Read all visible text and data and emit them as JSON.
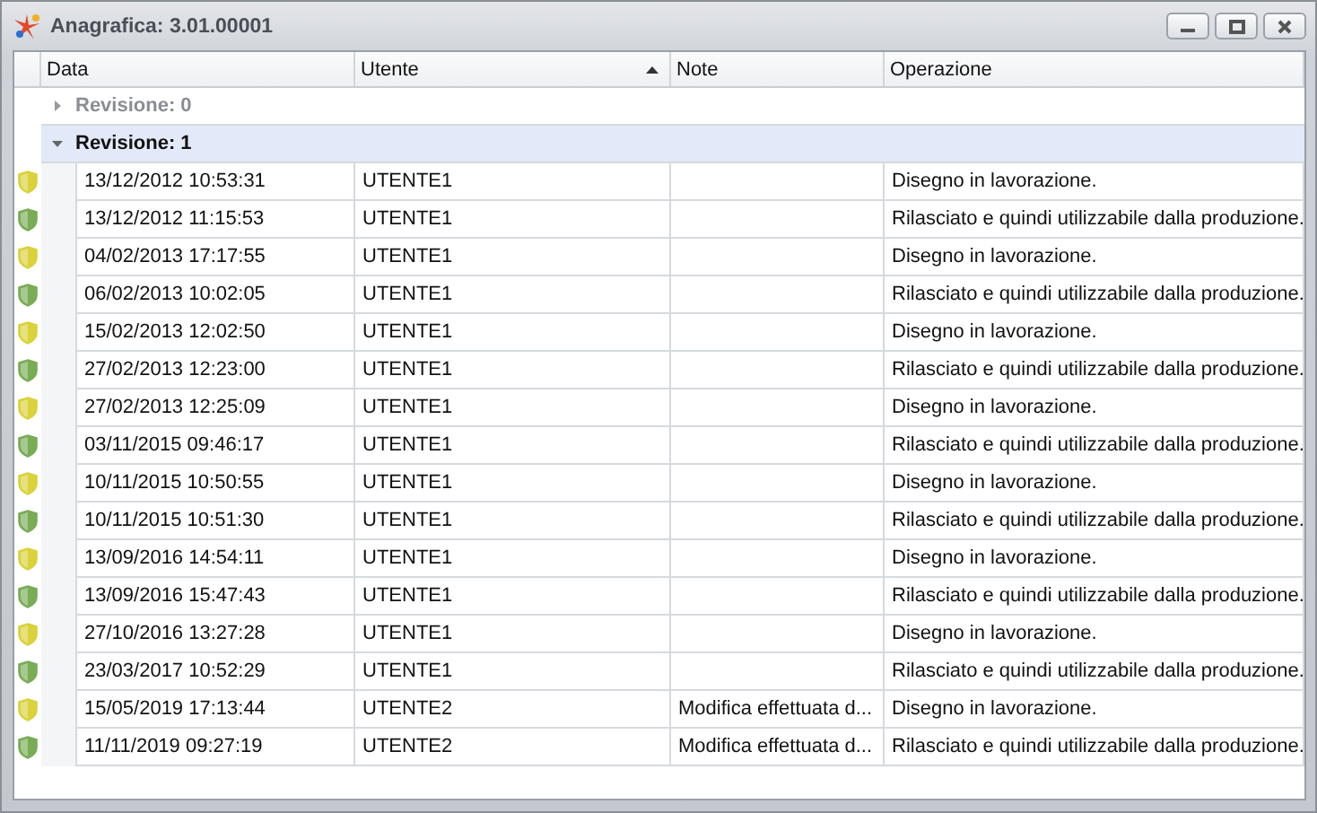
{
  "window": {
    "title": "Anagrafica: 3.01.00001"
  },
  "table": {
    "columns": [
      {
        "label": "Data",
        "sorted": false
      },
      {
        "label": "Utente",
        "sorted": true
      },
      {
        "label": "Note",
        "sorted": false
      },
      {
        "label": "Operazione",
        "sorted": false
      }
    ],
    "groups": [
      {
        "label": "Revisione: 0",
        "expanded": false,
        "selected": false
      },
      {
        "label": "Revisione: 1",
        "expanded": true,
        "selected": true,
        "rows": [
          {
            "color": "#d9d23a",
            "data": "13/12/2012 10:53:31",
            "utente": "UTENTE1",
            "note": "",
            "operazione": "Disegno in lavorazione."
          },
          {
            "color": "#78ac55",
            "data": "13/12/2012 11:15:53",
            "utente": "UTENTE1",
            "note": "",
            "operazione": "Rilasciato e quindi utilizzabile dalla produzione."
          },
          {
            "color": "#d9d23a",
            "data": "04/02/2013 17:17:55",
            "utente": "UTENTE1",
            "note": "",
            "operazione": "Disegno in lavorazione."
          },
          {
            "color": "#78ac55",
            "data": "06/02/2013 10:02:05",
            "utente": "UTENTE1",
            "note": "",
            "operazione": "Rilasciato e quindi utilizzabile dalla produzione."
          },
          {
            "color": "#d9d23a",
            "data": "15/02/2013 12:02:50",
            "utente": "UTENTE1",
            "note": "",
            "operazione": "Disegno in lavorazione."
          },
          {
            "color": "#78ac55",
            "data": "27/02/2013 12:23:00",
            "utente": "UTENTE1",
            "note": "",
            "operazione": "Rilasciato e quindi utilizzabile dalla produzione."
          },
          {
            "color": "#d9d23a",
            "data": "27/02/2013 12:25:09",
            "utente": "UTENTE1",
            "note": "",
            "operazione": "Disegno in lavorazione."
          },
          {
            "color": "#78ac55",
            "data": "03/11/2015 09:46:17",
            "utente": "UTENTE1",
            "note": "",
            "operazione": "Rilasciato e quindi utilizzabile dalla produzione."
          },
          {
            "color": "#d9d23a",
            "data": "10/11/2015 10:50:55",
            "utente": "UTENTE1",
            "note": "",
            "operazione": "Disegno in lavorazione."
          },
          {
            "color": "#78ac55",
            "data": "10/11/2015 10:51:30",
            "utente": "UTENTE1",
            "note": "",
            "operazione": "Rilasciato e quindi utilizzabile dalla produzione."
          },
          {
            "color": "#d9d23a",
            "data": "13/09/2016 14:54:11",
            "utente": "UTENTE1",
            "note": "",
            "operazione": "Disegno in lavorazione."
          },
          {
            "color": "#78ac55",
            "data": "13/09/2016 15:47:43",
            "utente": "UTENTE1",
            "note": "",
            "operazione": "Rilasciato e quindi utilizzabile dalla produzione."
          },
          {
            "color": "#d9d23a",
            "data": "27/10/2016 13:27:28",
            "utente": "UTENTE1",
            "note": "",
            "operazione": "Disegno in lavorazione."
          },
          {
            "color": "#78ac55",
            "data": "23/03/2017 10:52:29",
            "utente": "UTENTE1",
            "note": "",
            "operazione": "Rilasciato e quindi utilizzabile dalla produzione."
          },
          {
            "color": "#d9d23a",
            "data": "15/05/2019 17:13:44",
            "utente": "UTENTE2",
            "note": "Modifica effettuata d...",
            "operazione": "Disegno in lavorazione."
          },
          {
            "color": "#78ac55",
            "data": "11/11/2019 09:27:19",
            "utente": "UTENTE2",
            "note": "Modifica effettuata d...",
            "operazione": "Rilasciato e quindi utilizzabile dalla produzione."
          }
        ]
      }
    ]
  }
}
